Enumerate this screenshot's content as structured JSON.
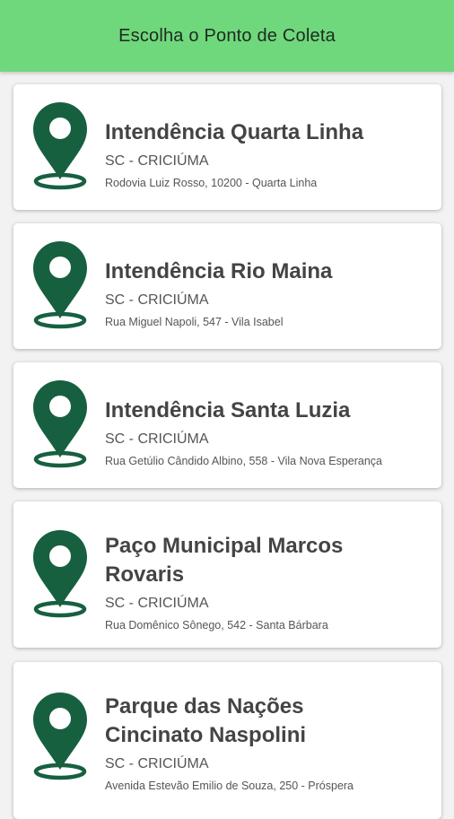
{
  "header": {
    "title": "Escolha o Ponto de Coleta"
  },
  "theme": {
    "header_color": "#6fd87c",
    "pin_color": "#17603f"
  },
  "points": [
    {
      "name": "Intendência Quarta Linha",
      "state_city": "SC - CRICIÚMA",
      "address": "Rodovia Luiz Rosso, 10200 - Quarta Linha",
      "icon": "location-pin-icon"
    },
    {
      "name": "Intendência Rio Maina",
      "state_city": "SC - CRICIÚMA",
      "address": "Rua Miguel Napoli, 547 - Vila Isabel",
      "icon": "location-pin-icon"
    },
    {
      "name": "Intendência Santa Luzia",
      "state_city": "SC - CRICIÚMA",
      "address": "Rua Getúlio Cândido Albino, 558 - Vila Nova Esperança",
      "icon": "location-pin-icon"
    },
    {
      "name": "Paço Municipal Marcos Rovaris",
      "state_city": "SC - CRICIÚMA",
      "address": "Rua Domênico Sônego, 542 - Santa Bárbara",
      "icon": "location-pin-icon"
    },
    {
      "name": "Parque das Nações Cincinato Naspolini",
      "state_city": "SC - CRICIÚMA",
      "address": "Avenida Estevão Emilio de Souza, 250 - Próspera",
      "icon": "location-pin-icon"
    }
  ]
}
